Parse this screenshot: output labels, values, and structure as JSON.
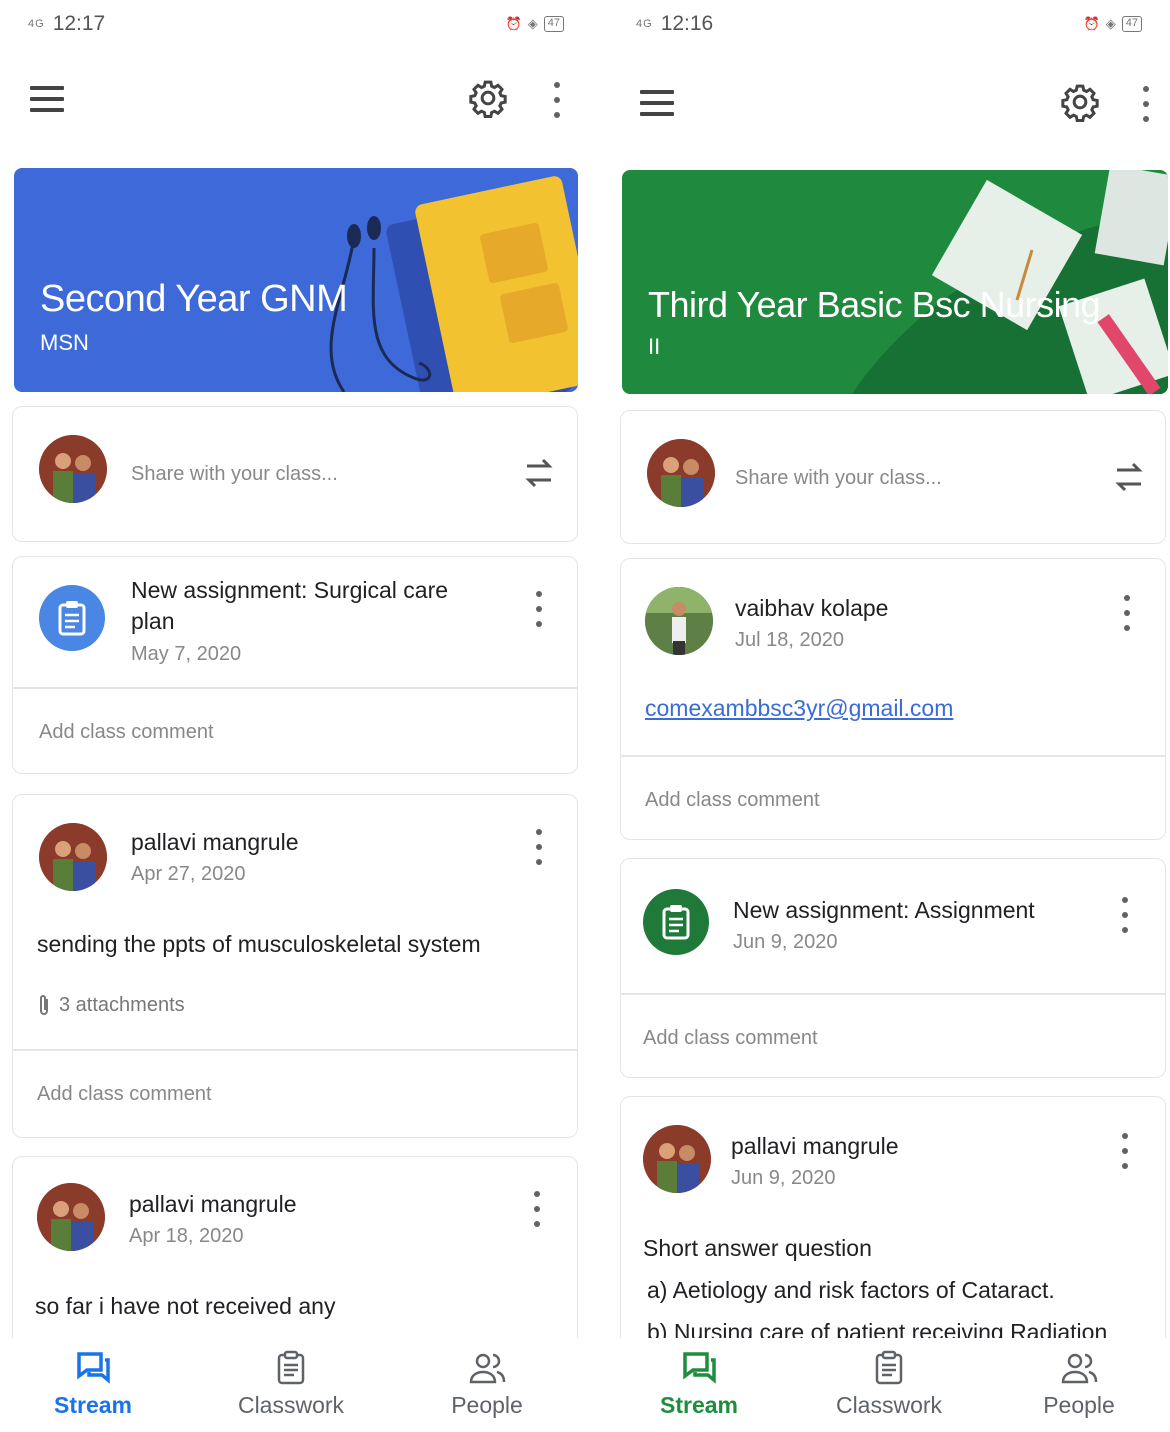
{
  "colors": {
    "blue_banner": "#3d6ad8",
    "green_banner": "#1f8a3e",
    "assignment_blue": "#4a86e3",
    "assignment_green": "#1f7a3a",
    "nav_active_left": "#1a73e8",
    "nav_active_right": "#1e8e3e",
    "link": "#3a6bd6"
  },
  "left": {
    "status": {
      "signal": "4G",
      "time": "12:17",
      "battery": "47"
    },
    "class": {
      "title": "Second Year GNM",
      "section": "MSN"
    },
    "share": {
      "placeholder": "Share with your class..."
    },
    "posts": [
      {
        "type": "assignment",
        "title": "New assignment: Surgical care plan",
        "date": "May 7, 2020",
        "comment": "Add class comment"
      },
      {
        "type": "post",
        "author": "pallavi mangrule",
        "date": "Apr 27, 2020",
        "text": "sending the ppts of musculoskeletal system",
        "attachments": "3 attachments",
        "comment": "Add class comment"
      },
      {
        "type": "post",
        "author": "pallavi mangrule",
        "date": "Apr 18, 2020",
        "text": "so far i have not received any"
      }
    ],
    "nav": [
      {
        "label": "Stream",
        "icon": "stream-icon"
      },
      {
        "label": "Classwork",
        "icon": "classwork-icon"
      },
      {
        "label": "People",
        "icon": "people-icon"
      }
    ]
  },
  "right": {
    "status": {
      "signal": "4G",
      "time": "12:16",
      "battery": "47"
    },
    "class": {
      "title": "Third Year Basic Bsc Nursing",
      "section": "II"
    },
    "share": {
      "placeholder": "Share with your class..."
    },
    "posts": [
      {
        "type": "post",
        "author": "vaibhav kolape",
        "date": "Jul 18, 2020",
        "link": "comexambbsc3yr@gmail.com",
        "comment": "Add class comment"
      },
      {
        "type": "assignment",
        "title": "New assignment: Assignment",
        "date": "Jun 9, 2020",
        "comment": "Add class comment"
      },
      {
        "type": "post",
        "author": "pallavi mangrule",
        "date": "Jun 9, 2020",
        "text": "Short answer question",
        "line2": "a) Aetiology and risk factors of Cataract.",
        "line3": "b) Nursing care of patient receiving Radiation"
      }
    ],
    "nav": [
      {
        "label": "Stream",
        "icon": "stream-icon"
      },
      {
        "label": "Classwork",
        "icon": "classwork-icon"
      },
      {
        "label": "People",
        "icon": "people-icon"
      }
    ]
  }
}
